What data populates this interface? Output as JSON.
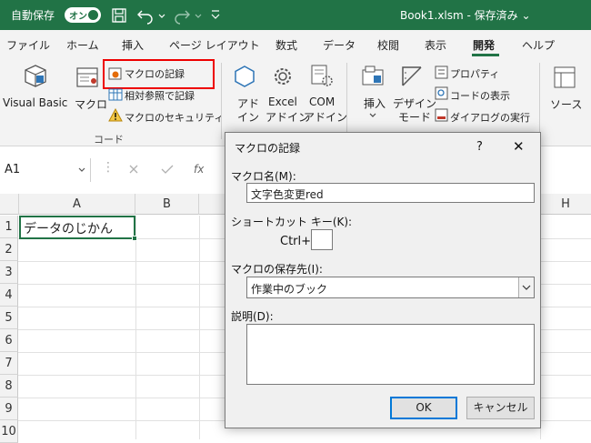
{
  "titlebar": {
    "autosave_label": "自動保存",
    "autosave_state": "オン",
    "file_title": "Book1.xlsm - 保存済み ⌄",
    "bg_color": "#217346"
  },
  "ribbon_tabs": [
    "ファイル",
    "ホーム",
    "挿入",
    "ページ レイアウト",
    "数式",
    "データ",
    "校閲",
    "表示",
    "開発",
    "ヘルプ"
  ],
  "ribbon": {
    "code": {
      "visual_basic": "Visual Basic",
      "macro": "マクロ",
      "record_macro": "マクロの記録",
      "relative_ref": "相対参照で記録",
      "macro_security": "マクロのセキュリティ",
      "group": "コード"
    },
    "addins": {
      "addin_line1": "アド",
      "addin_line2": "イン",
      "excel_line1": "Excel",
      "excel_line2": "アドイン",
      "com_line1": "COM",
      "com_line2": "アドイン"
    },
    "controls": {
      "insert": "挿入",
      "design_line1": "デザイン",
      "design_line2": "モード",
      "properties": "プロパティ",
      "view_code": "コードの表示",
      "run_dialog": "ダイアログの実行"
    },
    "source": "ソース"
  },
  "namebox": {
    "value": "A1"
  },
  "grid": {
    "columns": [
      "A",
      "B",
      "H"
    ],
    "rows": [
      "1",
      "2",
      "3",
      "4",
      "5",
      "6",
      "7",
      "8",
      "9",
      "10"
    ],
    "cell_a1": "データのじかん"
  },
  "dialog": {
    "title": "マクロの記録",
    "help": "?",
    "close": "✕",
    "macro_name_label": "マクロ名(M):",
    "macro_name_value": "文字色変更red",
    "shortcut_label": "ショートカット キー(K):",
    "ctrl_label": "Ctrl+",
    "store_label": "マクロの保存先(I):",
    "store_value": "作業中のブック",
    "desc_label": "説明(D):",
    "ok": "OK",
    "cancel": "キャンセル"
  }
}
